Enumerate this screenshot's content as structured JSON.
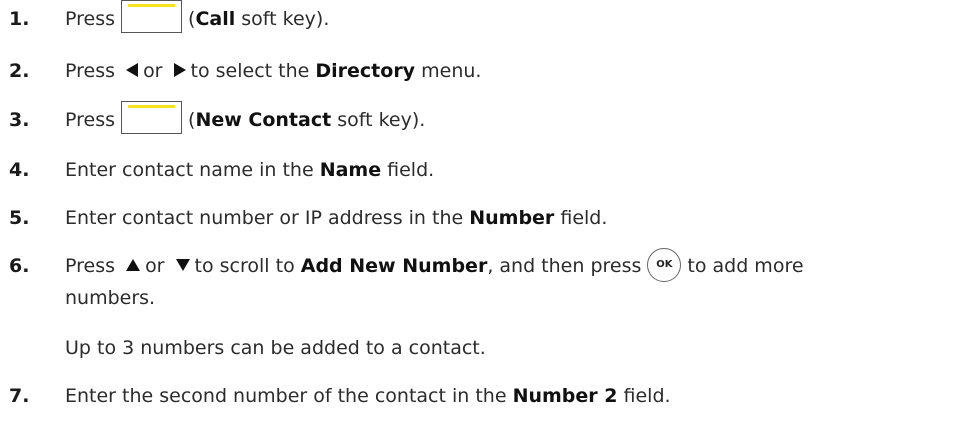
{
  "steps": [
    {
      "num": "1.",
      "a": "Press",
      "b": "(",
      "c": "Call",
      "d": " soft key)."
    },
    {
      "num": "2.",
      "a": "Press",
      "b": "or",
      "c": "to select the ",
      "d": "Directory",
      "e": " menu."
    },
    {
      "num": "3.",
      "a": "Press",
      "b": "(",
      "c": "New Contact",
      "d": " soft key)."
    },
    {
      "num": "4.",
      "a": "Enter contact name in the ",
      "b": "Name",
      "c": " field."
    },
    {
      "num": "5.",
      "a": "Enter contact number or IP address in the ",
      "b": "Number",
      "c": " field."
    },
    {
      "num": "6.",
      "a": "Press",
      "b": "or",
      "c": "to scroll to ",
      "d": "Add New Number",
      "e": ", and then press",
      "f": "to add more",
      "g": "numbers."
    },
    {
      "note": "Up to 3 numbers can be added to a contact."
    },
    {
      "num": "7.",
      "a": "Enter the second number of the contact in the ",
      "b": "Number 2",
      "c": " field."
    }
  ],
  "icons": {
    "softkey": "softkey-icon",
    "left": "left-arrow-icon",
    "right": "right-arrow-icon",
    "up": "up-arrow-icon",
    "down": "down-arrow-icon",
    "ok": "ok-key-icon"
  },
  "ok_label": "OK",
  "colors": {
    "softkey_bar": "#f3e51b"
  }
}
